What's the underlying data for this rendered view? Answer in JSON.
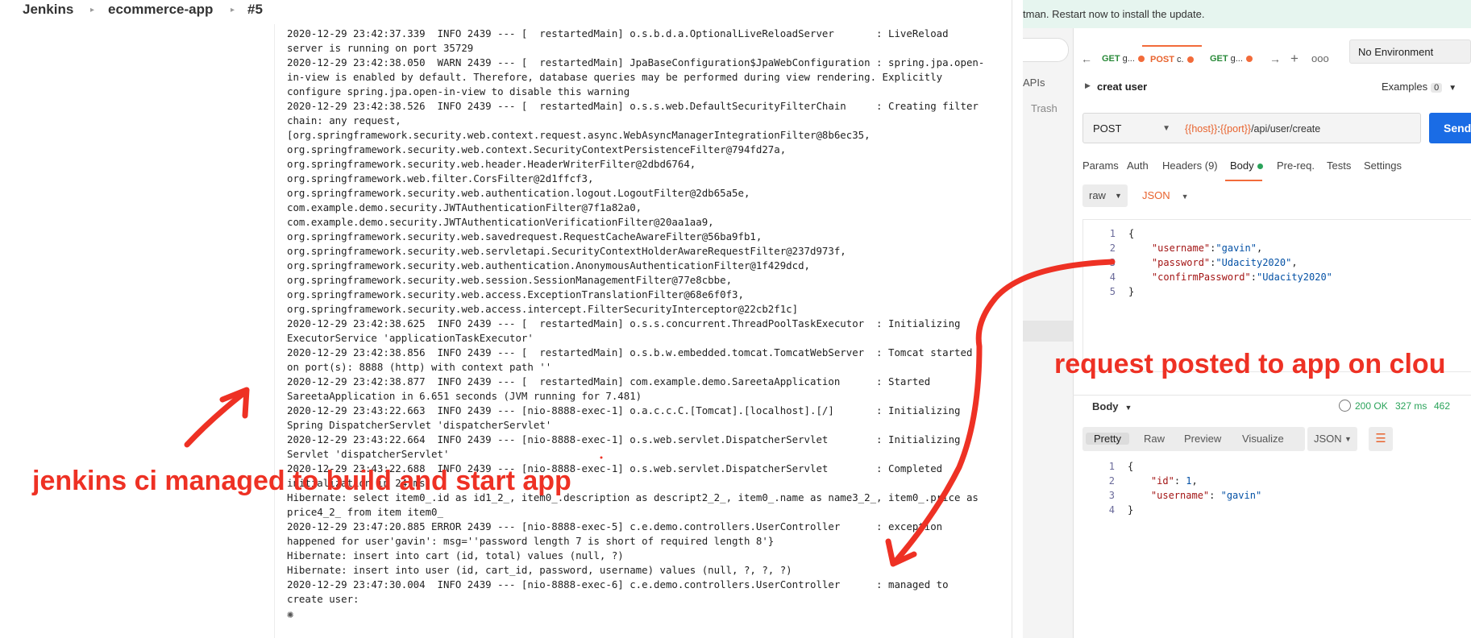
{
  "jenkins": {
    "breadcrumb": [
      "Jenkins",
      "ecommerce-app",
      "#5"
    ],
    "console_lines": [
      "2020-12-29 23:42:37.339  INFO 2439 --- [  restartedMain] o.s.b.d.a.OptionalLiveReloadServer       : LiveReload",
      "server is running on port 35729",
      "2020-12-29 23:42:38.050  WARN 2439 --- [  restartedMain] JpaBaseConfiguration$JpaWebConfiguration : spring.jpa.open-",
      "in-view is enabled by default. Therefore, database queries may be performed during view rendering. Explicitly",
      "configure spring.jpa.open-in-view to disable this warning",
      "2020-12-29 23:42:38.526  INFO 2439 --- [  restartedMain] o.s.s.web.DefaultSecurityFilterChain     : Creating filter",
      "chain: any request,",
      "[org.springframework.security.web.context.request.async.WebAsyncManagerIntegrationFilter@8b6ec35,",
      "org.springframework.security.web.context.SecurityContextPersistenceFilter@794fd27a,",
      "org.springframework.security.web.header.HeaderWriterFilter@2dbd6764,",
      "org.springframework.web.filter.CorsFilter@2d1ffcf3,",
      "org.springframework.security.web.authentication.logout.LogoutFilter@2db65a5e,",
      "com.example.demo.security.JWTAuthenticationFilter@7f1a82a0,",
      "com.example.demo.security.JWTAuthenticationVerificationFilter@20aa1aa9,",
      "org.springframework.security.web.savedrequest.RequestCacheAwareFilter@56ba9fb1,",
      "org.springframework.security.web.servletapi.SecurityContextHolderAwareRequestFilter@237d973f,",
      "org.springframework.security.web.authentication.AnonymousAuthenticationFilter@1f429dcd,",
      "org.springframework.security.web.session.SessionManagementFilter@77e8cbbe,",
      "org.springframework.security.web.access.ExceptionTranslationFilter@68e6f0f3,",
      "org.springframework.security.web.access.intercept.FilterSecurityInterceptor@22cb2f1c]",
      "2020-12-29 23:42:38.625  INFO 2439 --- [  restartedMain] o.s.s.concurrent.ThreadPoolTaskExecutor  : Initializing",
      "ExecutorService 'applicationTaskExecutor'",
      "2020-12-29 23:42:38.856  INFO 2439 --- [  restartedMain] o.s.b.w.embedded.tomcat.TomcatWebServer  : Tomcat started",
      "on port(s): 8888 (http) with context path ''",
      "2020-12-29 23:42:38.877  INFO 2439 --- [  restartedMain] com.example.demo.SareetaApplication      : Started",
      "SareetaApplication in 6.651 seconds (JVM running for 7.481)",
      "2020-12-29 23:43:22.663  INFO 2439 --- [nio-8888-exec-1] o.a.c.c.C.[Tomcat].[localhost].[/]       : Initializing",
      "Spring DispatcherServlet 'dispatcherServlet'",
      "2020-12-29 23:43:22.664  INFO 2439 --- [nio-8888-exec-1] o.s.web.servlet.DispatcherServlet        : Initializing",
      "Servlet 'dispatcherServlet'",
      "2020-12-29 23:43:22.688  INFO 2439 --- [nio-8888-exec-1] o.s.web.servlet.DispatcherServlet        : Completed",
      "initialization in 24 ms",
      "Hibernate: select item0_.id as id1_2_, item0_.description as descript2_2_, item0_.name as name3_2_, item0_.price as",
      "price4_2_ from item item0_",
      "2020-12-29 23:47:20.885 ERROR 2439 --- [nio-8888-exec-5] c.e.demo.controllers.UserController      : exception",
      "happened for user'gavin': msg=''password length 7 is short of required length 8'}",
      "Hibernate: insert into cart (id, total) values (null, ?)",
      "Hibernate: insert into user (id, cart_id, password, username) values (null, ?, ?, ?)",
      "2020-12-29 23:47:30.004  INFO 2439 --- [nio-8888-exec-6] c.e.demo.controllers.UserController      : managed to",
      "create user:"
    ],
    "spinner_icon": "spinner-icon"
  },
  "postman": {
    "banner_text": "tman. Restart now to install the update.",
    "sidebar": {
      "apis_label": "APIs",
      "trash_label": "Trash"
    },
    "tabs": [
      {
        "method": "GET",
        "label": "g..."
      },
      {
        "method": "POST",
        "label": "c."
      },
      {
        "method": "GET",
        "label": "g..."
      }
    ],
    "environment": "No Environment",
    "request_name": "creat user",
    "examples_label": "Examples",
    "examples_count": "0",
    "method": "POST",
    "url_var1": "{{host}}",
    "url_colon": ":",
    "url_var2": "{{port}}",
    "url_path": "/api/user/create",
    "send_label": "Send",
    "request_tabs": [
      "Params",
      "Auth",
      "Headers (9)",
      "Body",
      "Pre-req.",
      "Tests",
      "Settings"
    ],
    "body_mode": "raw",
    "body_lang": "JSON",
    "request_body": [
      {
        "ln": "1",
        "text": "{"
      },
      {
        "ln": "2",
        "key": "\"username\"",
        "sep": ":",
        "val": "\"gavin\"",
        "end": ","
      },
      {
        "ln": "3",
        "key": "\"password\"",
        "sep": ":",
        "val": "\"Udacity2020\"",
        "end": ","
      },
      {
        "ln": "4",
        "key": "\"confirmPassword\"",
        "sep": ":",
        "val": "\"Udacity2020\"",
        "end": ""
      },
      {
        "ln": "5",
        "text": "}"
      }
    ],
    "response": {
      "body_label": "Body",
      "status": "200 OK",
      "time": "327 ms",
      "size": "462",
      "views": [
        "Pretty",
        "Raw",
        "Preview",
        "Visualize"
      ],
      "format": "JSON",
      "lines": [
        {
          "ln": "1",
          "text": "{"
        },
        {
          "ln": "2",
          "key": "\"id\"",
          "sep": ": ",
          "val": "1",
          "end": ","
        },
        {
          "ln": "3",
          "key": "\"username\"",
          "sep": ": ",
          "val": "\"gavin\"",
          "end": ""
        },
        {
          "ln": "4",
          "text": "}"
        }
      ]
    },
    "colors": {
      "accent": "#f26b3a",
      "send": "#1a6ce5",
      "ok": "#2aa35a"
    }
  },
  "annotations": {
    "left_text": "jenkins ci managed to build and start app",
    "right_text": "request posted to app on clou",
    "color": "#ee3124"
  }
}
